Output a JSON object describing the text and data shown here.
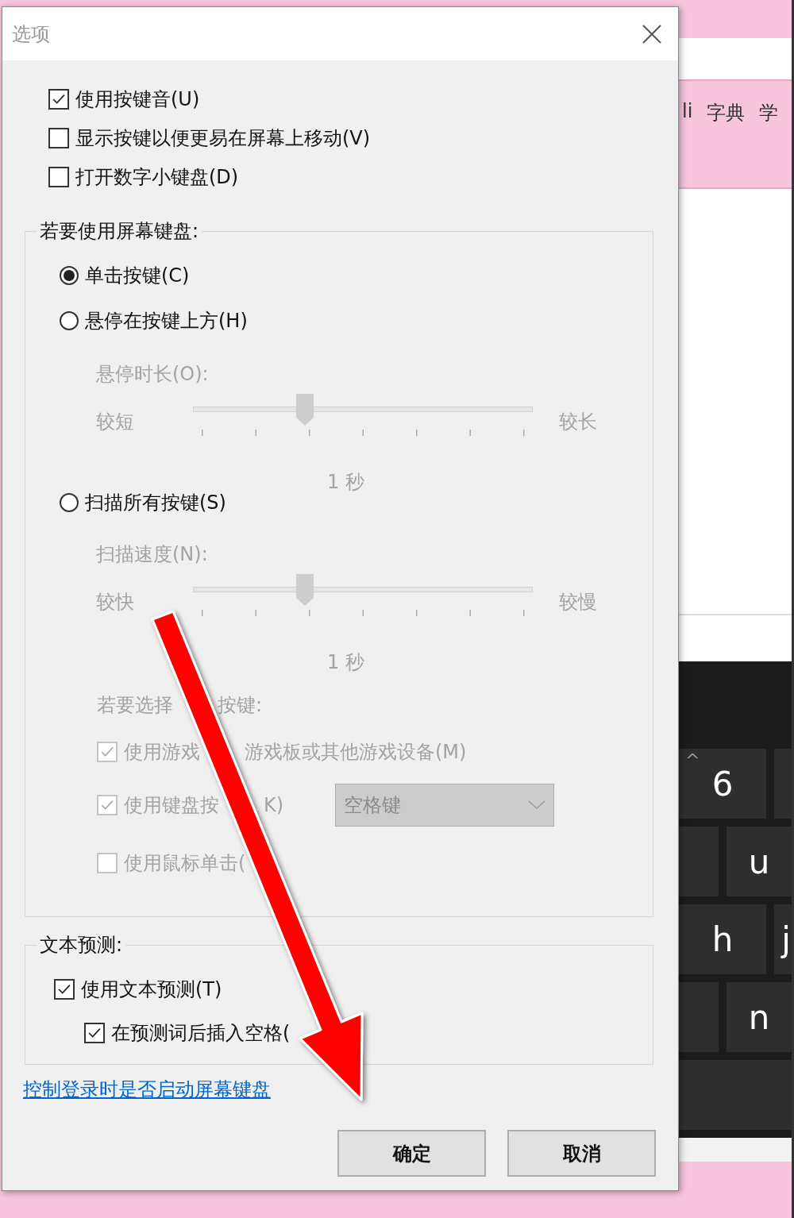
{
  "dialog": {
    "title": "选项"
  },
  "options": [
    {
      "label": "使用按键音(U)",
      "checked": true
    },
    {
      "label": "显示按键以便更易在屏幕上移动(V)",
      "checked": false
    },
    {
      "label": "打开数字小键盘(D)",
      "checked": false
    }
  ],
  "on_screen_keyboard": {
    "legend": "若要使用屏幕键盘:",
    "modes": [
      {
        "label": "单击按键(C)",
        "selected": true
      },
      {
        "label": "悬停在按键上方(H)",
        "selected": false,
        "setting": {
          "label": "悬停时长(O):",
          "min_label": "较短",
          "max_label": "较长",
          "level": 0.33,
          "value": "1 秒",
          "disabled": true
        }
      },
      {
        "label": "扫描所有按键(S)",
        "selected": false,
        "setting": {
          "label": "扫描速度(N):",
          "min_label": "较快",
          "max_label": "较慢",
          "level": 0.33,
          "value": "1 秒",
          "disabled": true
        }
      }
    ],
    "select_key": {
      "disabled": true,
      "label_parts": [
        "若要选择",
        "按键:"
      ],
      "options": [
        {
          "parts": [
            "使用游戏",
            "游戏板或其他游戏设备(M)"
          ],
          "checked": true
        },
        {
          "parts": [
            "使用键盘按",
            "K)"
          ],
          "checked": true,
          "dropdown": "空格键"
        },
        {
          "parts": [
            "使用鼠标单击("
          ],
          "checked": false
        }
      ]
    }
  },
  "text_prediction": {
    "legend": "文本预测:",
    "options": [
      {
        "label": "使用文本预测(T)",
        "checked": true,
        "children": [
          {
            "label": "在预测词后插入空格(",
            "checked": true
          }
        ]
      }
    ]
  },
  "link": "控制登录时是否启动屏幕键盘",
  "buttons": [
    "确定",
    "取消"
  ],
  "background": {
    "toolbar_items": [
      "li",
      "字典",
      "学"
    ],
    "keyboard_rows": [
      [
        {
          "top": "^",
          "main": "6"
        },
        {}
      ],
      [
        {},
        {
          "main": "u"
        }
      ],
      [
        {
          "main": "h"
        },
        {
          "main": "j"
        }
      ],
      [
        {},
        {
          "main": "n"
        }
      ],
      [
        {}
      ]
    ]
  }
}
